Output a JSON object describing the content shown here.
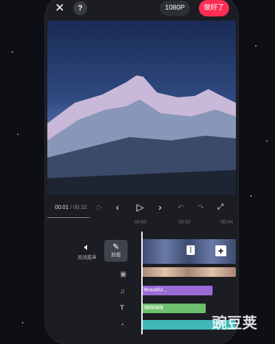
{
  "topbar": {
    "resolution": "1080P",
    "done_label": "做好了",
    "help": "?"
  },
  "playback": {
    "current": "00:01",
    "separator": " / ",
    "total": "00:32"
  },
  "ruler": [
    "00:00",
    "00:02",
    "00:04"
  ],
  "tools": {
    "mute_label": "关闭原声",
    "cover_label": "封面"
  },
  "tracks": {
    "text_clip": "Beautiful...",
    "sticker_clip": "嗨嗨嗨嗨"
  },
  "watermark": "豌豆荚",
  "colors": {
    "accent": "#fe2c55"
  }
}
